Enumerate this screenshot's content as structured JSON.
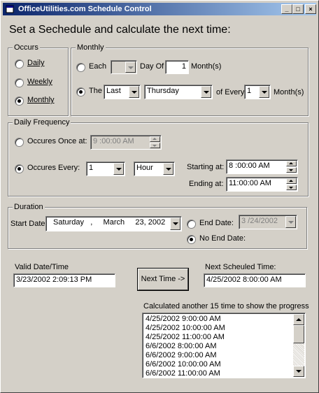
{
  "window": {
    "title": "OfficeUtilities.com Schedule Control",
    "minimize": "_",
    "maximize": "□",
    "close": "×"
  },
  "heading": "Set a Sechedule and calculate the next time:",
  "occurs": {
    "label": "Occurs",
    "daily": "Daily",
    "weekly": "Weekly",
    "monthly": "Monthly",
    "selected": "Monthly"
  },
  "monthly": {
    "label": "Monthly",
    "each_label": "Each",
    "each_day": "",
    "day_of_label": "Day Of",
    "day_of_value": "1",
    "months_label": "Month(s)",
    "the_label": "The",
    "ordinal": "Last",
    "weekday": "Thursday",
    "of_every_label": "of Every",
    "every_value": "1",
    "months_label2": "Month(s)",
    "selected": "The"
  },
  "daily_frequency": {
    "label": "Daily Frequency",
    "once_label": "Occures Once at:",
    "once_time": "9 :00:00 AM",
    "every_label": "Occures Every:",
    "every_value": "1",
    "unit": "Hour",
    "starting_label": "Starting at:",
    "starting_value": "8 :00:00 AM",
    "ending_label": "Ending at:",
    "ending_value": "11:00:00 AM",
    "selected": "Occures Every"
  },
  "duration": {
    "label": "Duration",
    "start_label": "Start Date:",
    "start_value": "Saturday   ,     March     23, 2002",
    "end_label": "End Date:",
    "end_value": "3 /24/2002",
    "no_end_label": "No End Date:",
    "selected": "No End Date"
  },
  "valid": {
    "label": "Valid Date/Time",
    "value": "3/23/2002 2:09:13 PM"
  },
  "next_button": "Next Time ->",
  "next_scheduled": {
    "label": "Next Scheuled Time:",
    "value": "4/25/2002 8:00:00 AM"
  },
  "progress": {
    "label": "Calculated another 15 time to show the progress",
    "items": [
      "4/25/2002 9:00:00 AM",
      "4/25/2002 10:00:00 AM",
      "4/25/2002 11:00:00 AM",
      "6/6/2002 8:00:00 AM",
      "6/6/2002 9:00:00 AM",
      "6/6/2002 10:00:00 AM",
      "6/6/2002 11:00:00 AM"
    ]
  }
}
